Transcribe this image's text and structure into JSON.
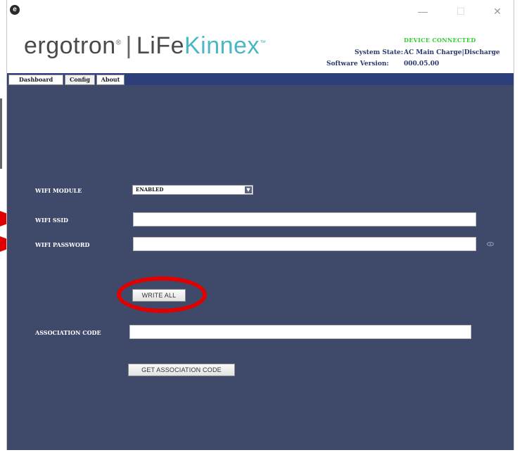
{
  "window": {
    "app_icon_glyph": "e",
    "minimize_glyph": "—",
    "maximize_glyph": "☐",
    "close_glyph": "✕"
  },
  "header": {
    "logo": {
      "brand": "ergotron",
      "reg_mark": "®",
      "separator": "|",
      "product_life": "LiFe",
      "product_kinnex": "Kinnex",
      "tm_mark": "™"
    },
    "connection_status": "DEVICE CONNECTED",
    "system_state_label": "System State:",
    "system_state_value": "AC Main Charge|Discharge",
    "software_version_label": "Software Version:",
    "software_version_value": "000.05.00"
  },
  "tabs": [
    {
      "label": "Dashboard",
      "active": false
    },
    {
      "label": "Config",
      "active": true
    },
    {
      "label": "About",
      "active": false
    }
  ],
  "config": {
    "wifi_module_label": "WIFI MODULE",
    "wifi_module_value": "ENABLED",
    "wifi_ssid_label": "WIFI SSID",
    "wifi_ssid_value": "",
    "wifi_password_label": "WIFI PASSWORD",
    "wifi_password_value": "",
    "write_all_label": "WRITE ALL",
    "association_code_label": "ASSOCIATION CODE",
    "association_code_value": "",
    "get_association_code_label": "GET ASSOCIATION CODE"
  },
  "colors": {
    "content_bg": "#3f4a6b",
    "tab_bar": "#2c3f7a",
    "connected_green": "#33cc33",
    "highlight_red": "#e00000",
    "kinnex_teal": "#4bb6c6"
  }
}
